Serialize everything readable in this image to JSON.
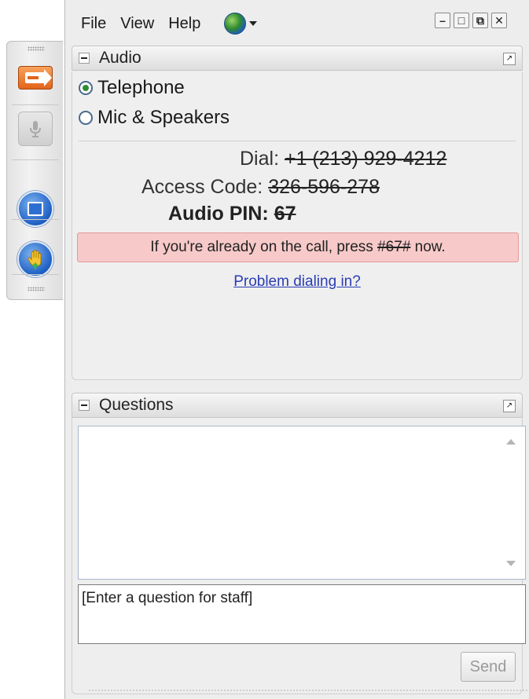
{
  "menu": {
    "file": "File",
    "view": "View",
    "help": "Help"
  },
  "window_controls": {
    "minimize": "–",
    "maximize": "□",
    "restore": "⧉",
    "close": "✕"
  },
  "toolbar": {
    "arrow_icon": "arrow-right-icon",
    "mic_icon": "microphone-icon",
    "stop_icon": "stop-icon",
    "raise_hand_icon": "raise-hand-icon"
  },
  "audio": {
    "title": "Audio",
    "options": [
      {
        "label": "Telephone",
        "selected": true
      },
      {
        "label": "Mic & Speakers",
        "selected": false
      }
    ],
    "dial_label": "Dial:",
    "dial_value": "+1 (213) 929-4212",
    "access_label": "Access Code:",
    "access_value": "326-596-278",
    "pin_label": "Audio PIN:",
    "pin_value": "67",
    "notice_before": "If you're already on the call, press ",
    "notice_code": "#67#",
    "notice_after": " now.",
    "problem_link": "Problem dialing in?"
  },
  "questions": {
    "title": "Questions",
    "input_value": "[Enter a question for staff]",
    "send_label": "Send"
  },
  "colors": {
    "notice_bg": "#f7c9c9",
    "link": "#2a3cb6",
    "selected_radio": "#2e8b32"
  }
}
